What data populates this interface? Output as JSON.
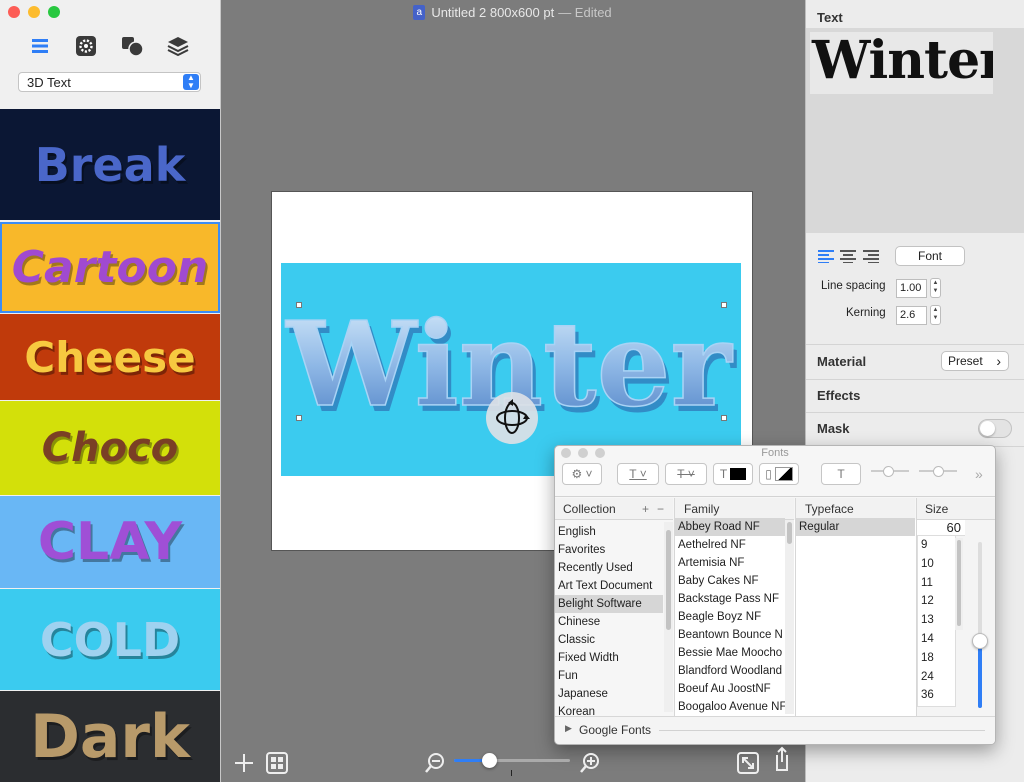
{
  "window": {
    "title": "Untitled 2 800x600 pt",
    "edited_label": "— Edited"
  },
  "sidebar": {
    "tools": [
      "list-icon",
      "gear-icon",
      "shapes-icon",
      "layers-icon"
    ],
    "style_select": "3D Text",
    "thumbnails": [
      {
        "label": "Break",
        "bg": "#0b1734",
        "fg": "#4a67c9"
      },
      {
        "label": "Cartoon",
        "bg": "#f8b82a",
        "fg": "#a04ad0"
      },
      {
        "label": "Cheese",
        "bg": "#c03a0b",
        "fg": "#f7c940"
      },
      {
        "label": "Choco",
        "bg": "#d3e00a",
        "fg": "#7a3f25"
      },
      {
        "label": "CLAY",
        "bg": "#69b7f5",
        "fg": "#9f4fd6"
      },
      {
        "label": "COLD",
        "bg": "#3bcbef",
        "fg": "#9fd2f0"
      },
      {
        "label": "Dark",
        "bg": "#2b2d30",
        "fg": "#b89a6a"
      }
    ]
  },
  "canvas": {
    "banner_text": "Winter",
    "banner_color": "#3bcbef"
  },
  "right_panel": {
    "text_header": "Text",
    "preview_text": "Winter",
    "font_button": "Font",
    "line_spacing_label": "Line spacing",
    "line_spacing_value": "1.00",
    "kerning_label": "Kerning",
    "kerning_value": "2.6",
    "material_label": "Material",
    "preset_button": "Preset",
    "effects_label": "Effects",
    "mask_label": "Mask",
    "mask_on": false
  },
  "fonts_panel": {
    "title": "Fonts",
    "collection_header": "Collection",
    "family_header": "Family",
    "typeface_header": "Typeface",
    "size_header": "Size",
    "collections": [
      "English",
      "Favorites",
      "Recently Used",
      "Art Text Document",
      "Belight Software",
      "Chinese",
      "Classic",
      "Fixed Width",
      "Fun",
      "Japanese",
      "Korean"
    ],
    "selected_collection": "Belight Software",
    "families": [
      "Abbey Road NF",
      "Aethelred NF",
      "Artemisia NF",
      "Baby Cakes NF",
      "Backstage Pass NF",
      "Beagle Boyz NF",
      "Beantown Bounce N",
      "Bessie Mae Moocho",
      "Blandford Woodland",
      "Boeuf Au JoostNF",
      "Boogaloo Avenue NF"
    ],
    "selected_family": "Abbey Road NF",
    "typefaces": [
      "Regular"
    ],
    "size_value": "60",
    "sizes": [
      "9",
      "10",
      "11",
      "12",
      "13",
      "14",
      "18",
      "24",
      "36"
    ],
    "google_fonts_label": "Google Fonts",
    "size_slider_fraction": 0.4
  },
  "bottom_toolbar": {
    "zoom_fraction": 0.3
  }
}
